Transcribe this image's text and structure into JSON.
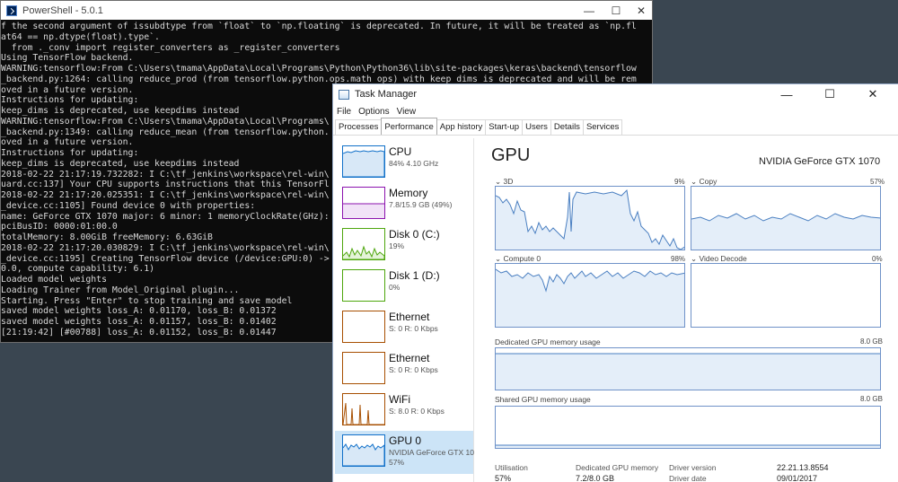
{
  "powershell": {
    "title": "PowerShell - 5.0.1",
    "controls": {
      "min": "—",
      "max": "☐",
      "close": "✕"
    },
    "lines": [
      "f the second argument of issubdtype from `float` to `np.floating` is deprecated. In future, it will be treated as `np.fl",
      "at64 == np.dtype(float).type`.",
      "  from ._conv import register_converters as _register_converters",
      "Using TensorFlow backend.",
      "WARNING:tensorflow:From C:\\Users\\tmama\\AppData\\Local\\Programs\\Python\\Python36\\lib\\site-packages\\keras\\backend\\tensorflow",
      "_backend.py:1264: calling reduce_prod (from tensorflow.python.ops.math_ops) with keep_dims is deprecated and will be rem",
      "oved in a future version.",
      "Instructions for updating:",
      "keep_dims is deprecated, use keepdims instead",
      "WARNING:tensorflow:From C:\\Users\\tmama\\AppData\\Local\\Programs\\",
      "_backend.py:1349: calling reduce_mean (from tensorflow.python.",
      "oved in a future version.",
      "Instructions for updating:",
      "keep_dims is deprecated, use keepdims instead",
      "2018-02-22 21:17:19.732282: I C:\\tf_jenkins\\workspace\\rel-win\\",
      "uard.cc:137] Your CPU supports instructions that this TensorFl",
      "2018-02-22 21:17:20.025351: I C:\\tf_jenkins\\workspace\\rel-win\\",
      "_device.cc:1105] Found device 0 with properties:",
      "name: GeForce GTX 1070 major: 6 minor: 1 memoryClockRate(GHz):",
      "pciBusID: 0000:01:00.0",
      "totalMemory: 8.00GiB freeMemory: 6.63GiB",
      "2018-02-22 21:17:20.030829: I C:\\tf_jenkins\\workspace\\rel-win\\",
      "_device.cc:1195] Creating TensorFlow device (/device:GPU:0) ->",
      "0.0, compute capability: 6.1)",
      "Loaded model weights",
      "Loading Trainer from Model_Original plugin...",
      "Starting. Press \"Enter\" to stop training and save model",
      "saved model weights loss_A: 0.01170, loss_B: 0.01372",
      "saved model weights loss_A: 0.01157, loss_B: 0.01402",
      "[21:19:42] [#00788] loss_A: 0.01152, loss_B: 0.01447"
    ]
  },
  "taskmanager": {
    "title": "Task Manager",
    "controls": {
      "min": "—",
      "max": "☐",
      "close": "✕"
    },
    "menu": [
      "File",
      "Options",
      "View"
    ],
    "tabs": [
      "Processes",
      "Performance",
      "App history",
      "Start-up",
      "Users",
      "Details",
      "Services"
    ],
    "active_tab": "Performance",
    "sidebar": [
      {
        "name": "CPU",
        "sub": "84% 4.10 GHz",
        "sub2": "",
        "color": "#1170c9"
      },
      {
        "name": "Memory",
        "sub": "7.8/15.9 GB (49%)",
        "sub2": "",
        "color": "#8b12ae"
      },
      {
        "name": "Disk 0 (C:)",
        "sub": "19%",
        "sub2": "",
        "color": "#4da60c"
      },
      {
        "name": "Disk 1 (D:)",
        "sub": "0%",
        "sub2": "",
        "color": "#4da60c"
      },
      {
        "name": "Ethernet",
        "sub": "S: 0 R: 0 Kbps",
        "sub2": "",
        "color": "#a74f01"
      },
      {
        "name": "Ethernet",
        "sub": "S: 0 R: 0 Kbps",
        "sub2": "",
        "color": "#a74f01"
      },
      {
        "name": "WiFi",
        "sub": "S: 8.0 R: 0 Kbps",
        "sub2": "",
        "color": "#a74f01"
      },
      {
        "name": "GPU 0",
        "sub": "NVIDIA GeForce GTX 10",
        "sub2": "57%",
        "color": "#1170c9"
      }
    ],
    "gpu": {
      "heading": "GPU",
      "model": "NVIDIA GeForce GTX 1070",
      "graphs": {
        "3d": {
          "label": "3D",
          "pct": "9%"
        },
        "copy": {
          "label": "Copy",
          "pct": "57%"
        },
        "compute": {
          "label": "Compute 0",
          "pct": "98%"
        },
        "video_decode": {
          "label": "Video Decode",
          "pct": "0%"
        },
        "dedicated": {
          "label": "Dedicated GPU memory usage",
          "max": "8.0 GB"
        },
        "shared": {
          "label": "Shared GPU memory usage",
          "max": "8.0 GB"
        }
      },
      "stats": {
        "utilisation": {
          "label": "Utilisation",
          "value": "57%"
        },
        "dedicated_memory": {
          "label": "Dedicated GPU memory",
          "value": "7.2/8.0 GB"
        },
        "driver_version": {
          "label": "Driver version",
          "value": "22.21.13.8554"
        },
        "driver_date": {
          "label": "Driver date",
          "value": "09/01/2017"
        }
      }
    }
  }
}
